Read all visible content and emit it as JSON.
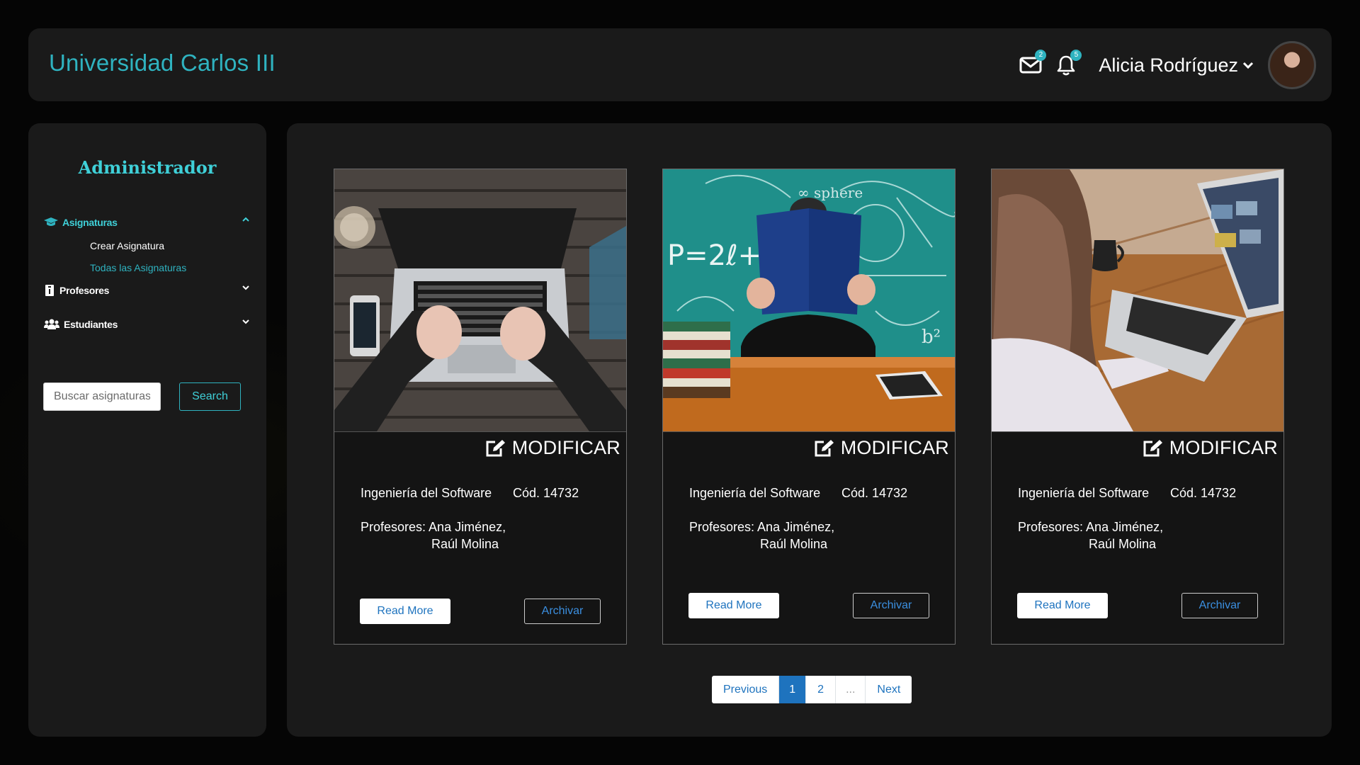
{
  "brand": "Universidad Carlos III",
  "header": {
    "mail_badge": "2",
    "bell_badge": "5",
    "user_name": "Alicia Rodríguez"
  },
  "sidebar": {
    "role_title": "Administrador",
    "menu": {
      "asignaturas": "Asignaturas",
      "crear": "Crear Asignatura",
      "todas": "Todas las Asignaturas",
      "profesores": "Profesores",
      "estudiantes": "Estudiantes"
    },
    "search_placeholder": "Buscar asignaturas",
    "search_button": "Search"
  },
  "cards": [
    {
      "image": "laptop-typing-photo",
      "modify": "MODIFICAR",
      "course": "Ingeniería del Software",
      "code": "Cód. 14732",
      "profs_line1": "Profesores: Ana Jiménez,",
      "profs_line2": "Raúl Molina",
      "read_more": "Read More",
      "archive": "Archivar"
    },
    {
      "image": "person-reading-chalkboard-photo",
      "modify": "MODIFICAR",
      "course": "Ingeniería del Software",
      "code": "Cód. 14732",
      "profs_line1": "Profesores: Ana Jiménez,",
      "profs_line2": "Raúl Molina",
      "read_more": "Read More",
      "archive": "Archivar"
    },
    {
      "image": "woman-laptop-photo",
      "modify": "MODIFICAR",
      "course": "Ingeniería del Software",
      "code": "Cód. 14732",
      "profs_line1": "Profesores: Ana Jiménez,",
      "profs_line2": "Raúl Molina",
      "read_more": "Read More",
      "archive": "Archivar"
    }
  ],
  "pagination": {
    "previous": "Previous",
    "page1": "1",
    "page2": "2",
    "ellipsis": "...",
    "next": "Next",
    "current": "1"
  },
  "colors": {
    "accent": "#2fb3c0",
    "link_blue": "#1e73be",
    "panel": "#1a1a1a",
    "background": "#050505"
  }
}
